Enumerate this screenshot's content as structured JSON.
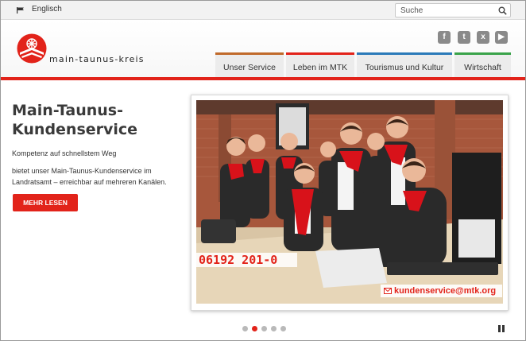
{
  "topbar": {
    "language_link": "Englisch",
    "search_placeholder": "Suche"
  },
  "header": {
    "logo_text": "main-taunus-kreis",
    "social_icons": [
      "facebook-icon",
      "twitter-icon",
      "xing-icon",
      "youtube-icon"
    ],
    "nav_tabs": [
      {
        "label": "Unser Service",
        "color": "#c06a2b"
      },
      {
        "label": "Leben im MTK",
        "color": "#e2231a"
      },
      {
        "label": "Tourismus und Kultur",
        "color": "#2a7ab9"
      },
      {
        "label": "Wirtschaft",
        "color": "#3aa34a"
      }
    ]
  },
  "main": {
    "title_line1": "Main-Taunus-",
    "title_line2": "Kundenservice",
    "subtitle": "Kompetenz auf schnellstem Weg",
    "body": "bietet unser Main-Taunus-Kundenservice im Landratsamt – erreichbar auf mehreren Kanälen.",
    "more_button": "MEHR LESEN"
  },
  "slider": {
    "phone": "06192 201-0",
    "email": "kundenservice@mtk.org",
    "slide_count": 5,
    "active_slide": 2
  },
  "colors": {
    "brand_red": "#e2231a",
    "nav_bg": "#ececec"
  }
}
